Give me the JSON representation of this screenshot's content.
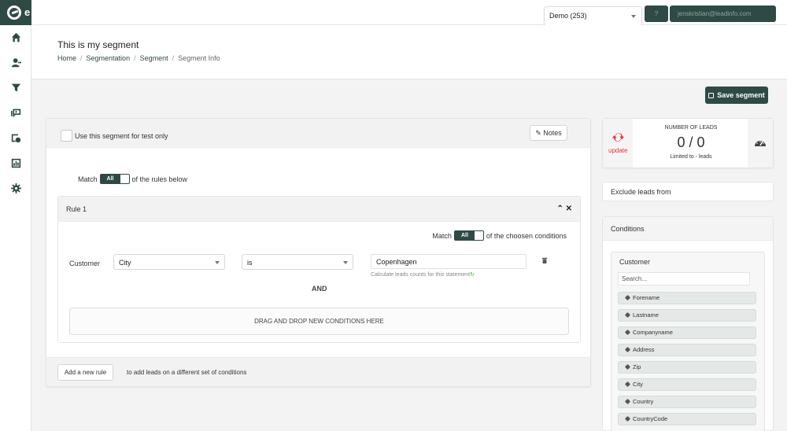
{
  "nav": {
    "logo_letter": "e",
    "icons": [
      "home-icon",
      "user-icon",
      "filter-icon",
      "message-icon",
      "campaign-icon",
      "report-icon",
      "gear-icon"
    ]
  },
  "topbar": {
    "account_select": "Demo (253)",
    "help_label": "?",
    "user_label": "jenskristian@leadinfo.com"
  },
  "header": {
    "title": "This is my segment",
    "breadcrumbs": [
      "Home",
      "Segmentation",
      "Segment",
      "Segment Info"
    ]
  },
  "actions": {
    "save_label": "Save segment"
  },
  "main": {
    "test_only_label": "Use this segment for test only",
    "notes_label": "Notes",
    "match_prefix": "Match",
    "match_value": "All",
    "match_suffix": "of the rules below",
    "rule": {
      "title": "Rule 1",
      "match_prefix": "Match",
      "match_value": "All",
      "match_suffix": "of the choosen conditions",
      "field_label": "Customer",
      "field_select": "City",
      "operator_select": "is",
      "value": "Copenhagen",
      "hint": "Calculate leads counts for this statement",
      "and_label": "AND",
      "drop_label": "DRAG AND DROP NEW CONDITIONS HERE"
    },
    "add_rule_label": "Add a new rule",
    "add_rule_hint": "to add leads on a different set of conditions"
  },
  "leads": {
    "update_label": "update",
    "heading": "NUMBER OF LEADS",
    "count": "0 / 0",
    "limited": "Limited to - leads"
  },
  "exclude_label": "Exclude leads from",
  "conditions": {
    "title": "Conditions",
    "group_title": "Customer",
    "search_placeholder": "Search...",
    "fields": [
      "Forename",
      "Lastname",
      "Companyname",
      "Address",
      "Zip",
      "City",
      "Country",
      "CountryCode"
    ]
  },
  "colors": {
    "brand": "#2f4a44",
    "update": "#e3323b",
    "refresh": "#3fae49"
  }
}
